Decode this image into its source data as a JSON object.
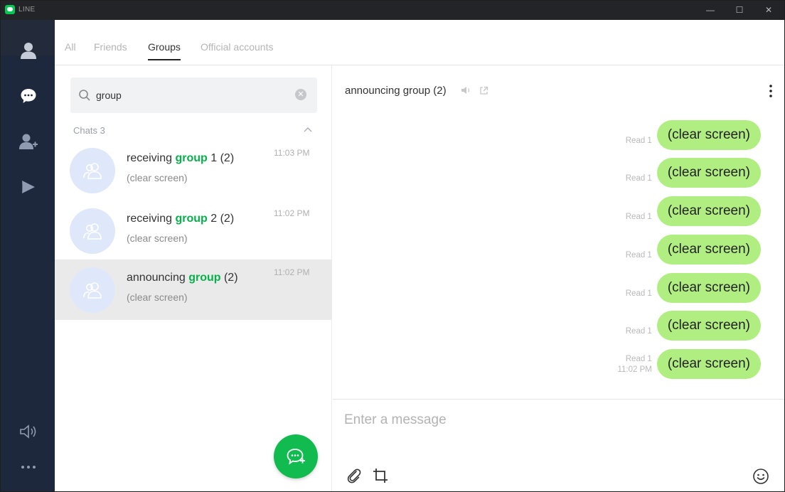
{
  "window": {
    "title": "LINE"
  },
  "titlebar": {
    "minimize": "—",
    "maximize": "☐",
    "close": "✕"
  },
  "rail": {
    "items": [
      {
        "name": "friends",
        "icon": "person-icon"
      },
      {
        "name": "chats",
        "icon": "chat-bubble-icon",
        "active": true
      },
      {
        "name": "add-friends",
        "icon": "add-person-icon"
      },
      {
        "name": "timeline",
        "icon": "play-icon"
      }
    ],
    "bottom": [
      {
        "name": "notifications",
        "icon": "speaker-icon"
      },
      {
        "name": "more",
        "icon": "more-dots-icon"
      }
    ]
  },
  "tabs": [
    {
      "label": "All",
      "active": false
    },
    {
      "label": "Friends",
      "active": false
    },
    {
      "label": "Groups",
      "active": true
    },
    {
      "label": "Official accounts",
      "active": false
    }
  ],
  "search": {
    "value": "group",
    "placeholder": ""
  },
  "chats_section": {
    "label": "Chats 3"
  },
  "chats": [
    {
      "name_before": "receiving ",
      "name_match": "group",
      "name_after": " 1 (2)",
      "preview": "(clear screen)",
      "time": "11:03 PM",
      "selected": false
    },
    {
      "name_before": "receiving ",
      "name_match": "group",
      "name_after": " 2 (2)",
      "preview": "(clear screen)",
      "time": "11:02 PM",
      "selected": false
    },
    {
      "name_before": "announcing ",
      "name_match": "group",
      "name_after": " (2)",
      "preview": "(clear screen)",
      "time": "11:02 PM",
      "selected": true
    }
  ],
  "conversation": {
    "title": "announcing group (2)",
    "messages": [
      {
        "read": "Read 1",
        "time": "",
        "text": "(clear screen)"
      },
      {
        "read": "Read 1",
        "time": "",
        "text": "(clear screen)"
      },
      {
        "read": "Read 1",
        "time": "",
        "text": "(clear screen)"
      },
      {
        "read": "Read 1",
        "time": "",
        "text": "(clear screen)"
      },
      {
        "read": "Read 1",
        "time": "",
        "text": "(clear screen)"
      },
      {
        "read": "Read 1",
        "time": "",
        "text": "(clear screen)"
      },
      {
        "read": "Read 1",
        "time": "11:02 PM",
        "text": "(clear screen)"
      }
    ],
    "composer_placeholder": "Enter a message"
  },
  "colors": {
    "accent": "#06c755",
    "bubble": "#b1ee82",
    "rail": "#1e283c",
    "highlight": "#06b14a"
  }
}
